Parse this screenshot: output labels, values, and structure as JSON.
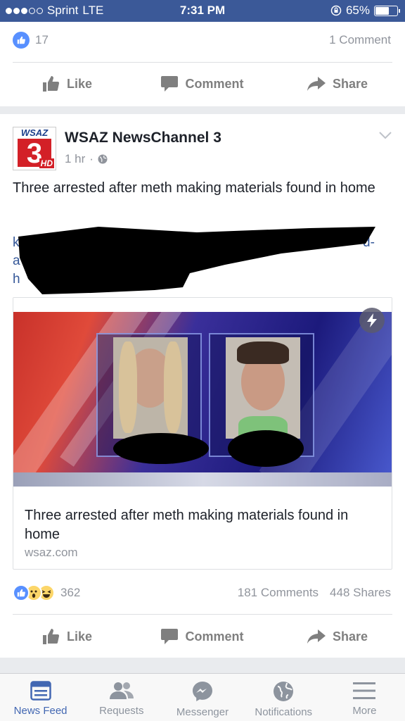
{
  "status_bar": {
    "carrier": "Sprint",
    "network": "LTE",
    "time": "7:31 PM",
    "battery_text": "65%",
    "battery_level": 0.65
  },
  "prev_post": {
    "like_count": "17",
    "comments": "1 Comment",
    "actions": {
      "like": "Like",
      "comment": "Comment",
      "share": "Share"
    }
  },
  "post": {
    "page_name": "WSAZ NewsChannel 3",
    "logo": {
      "top": "WSAZ",
      "number": "3",
      "badge": "HD"
    },
    "time": "1 hr",
    "separator": "·",
    "audience_icon": "globe-icon",
    "text": "Three arrested after meth making materials found in home",
    "link_fragments": {
      "a": "a",
      "h": "h",
      "d": "d-",
      "k": "k"
    },
    "link_card": {
      "title": "Three arrested after meth making materials found in home",
      "domain": "wsaz.com",
      "badge_icon": "lightning-icon"
    },
    "reactions": {
      "types": [
        "like",
        "wow",
        "haha"
      ],
      "count": "362"
    },
    "comments": "181 Comments",
    "shares": "448 Shares",
    "actions": {
      "like": "Like",
      "comment": "Comment",
      "share": "Share"
    }
  },
  "tabbar": {
    "items": [
      {
        "label": "News Feed",
        "icon": "news-feed-icon",
        "active": true
      },
      {
        "label": "Requests",
        "icon": "friends-icon",
        "active": false
      },
      {
        "label": "Messenger",
        "icon": "messenger-icon",
        "active": false
      },
      {
        "label": "Notifications",
        "icon": "globe-icon",
        "active": false
      },
      {
        "label": "More",
        "icon": "menu-icon",
        "active": false
      }
    ]
  },
  "colors": {
    "brand": "#3b5998",
    "link": "#365899",
    "active_tab": "#4267b2",
    "like_blue": "#5890ff",
    "muted": "#90949c"
  }
}
